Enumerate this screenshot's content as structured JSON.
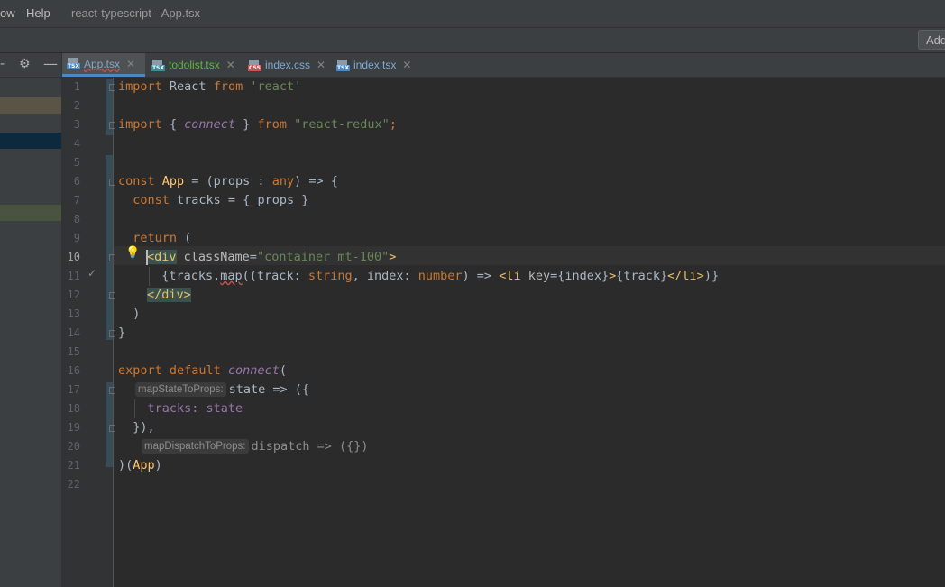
{
  "menu": {
    "items": [
      "ow",
      "Help"
    ],
    "title": "react-typescript - App.tsx"
  },
  "toolbar": {
    "add_label": "Add"
  },
  "tabs": [
    {
      "name": "App.tsx",
      "type": "TSX",
      "active": true,
      "color": "#4a88c7"
    },
    {
      "name": "todolist.tsx",
      "type": "TSX",
      "active": false,
      "color": "#62b543"
    },
    {
      "name": "index.css",
      "type": "CSS",
      "active": false,
      "color": "#c75450"
    },
    {
      "name": "index.tsx",
      "type": "TSX",
      "active": false,
      "color": "#4a88c7"
    }
  ],
  "editor": {
    "line_numbers": [
      "1",
      "2",
      "3",
      "4",
      "5",
      "6",
      "7",
      "8",
      "9",
      "10",
      "11",
      "12",
      "13",
      "14",
      "15",
      "16",
      "17",
      "18",
      "19",
      "20",
      "21",
      "22"
    ],
    "code": {
      "l1_import": "import",
      "l1_react": " React ",
      "l1_from": "from",
      "l1_str": " 'react'",
      "l3_import": "import",
      "l3_open": " { ",
      "l3_connect": "connect",
      "l3_close": " } ",
      "l3_from": "from",
      "l3_str": " \"react-redux\"",
      "l3_semi": ";",
      "l6_const": "const",
      "l6_app": " App",
      "l6_rest": " = (props : ",
      "l6_any": "any",
      "l6_end": ") => {",
      "l7_const": "  const",
      "l7_rest": " tracks = { props }",
      "l9_return": "  return",
      "l9_rest": " (",
      "l10_tag": "<div",
      "l10_attr": " className",
      "l10_eq": "=",
      "l10_str": "\"container mt-100\"",
      "l10_end": ">",
      "l11_a": "  {tracks.",
      "l11_map": "map",
      "l11_b": "((track: ",
      "l11_string": "string",
      "l11_c": ", index: ",
      "l11_number": "number",
      "l11_d": ") => ",
      "l11_li": "<li",
      "l11_key": " key",
      "l11_e": "={index}",
      "l11_gt": ">",
      "l11_f": "{track}",
      "l11_cli": "</li>",
      "l11_g": ")}",
      "l12_tag": "</div>",
      "l13": "  )",
      "l14": "}",
      "l16_export": "export default ",
      "l16_connect": "connect",
      "l16_paren": "(",
      "l17_hint": "mapStateToProps:",
      "l17_code": "state => ({",
      "l18": "    tracks: state",
      "l19": "  }),",
      "l20_hint": "mapDispatchToProps:",
      "l20_code": "dispatch => ({})",
      "l21_a": ")(",
      "l21_app": "App",
      "l21_b": ")"
    }
  },
  "colors": {
    "keyword": "#cc7832",
    "string": "#6a8759",
    "function": "#9876aa",
    "tag": "#e8bf6a",
    "text": "#a9b7c6"
  }
}
